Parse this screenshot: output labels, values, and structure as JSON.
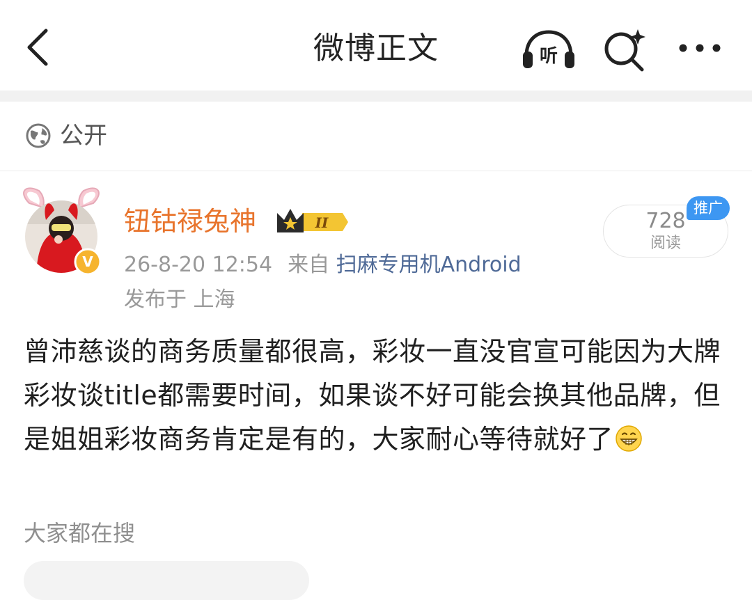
{
  "header": {
    "title": "微博正文",
    "listen_label": "听"
  },
  "visibility": {
    "label": "公开"
  },
  "post": {
    "author": "钮钴禄兔神",
    "rank_badge": "II",
    "timestamp": "26-8-20 12:54",
    "source_prefix": "来自",
    "source_name": "扫麻专用机Android",
    "location": "发布于 上海",
    "read_count": "728",
    "read_label": "阅读",
    "promo_tag": "推广",
    "body_text": "曾沛慈谈的商务质量都很高，彩妆一直没官宣可能因为大牌彩妆谈title都需要时间，如果谈不好可能会换其他品牌，但是姐姐彩妆商务肯定是有的，大家耐心等待就好了",
    "verified_badge": "V"
  },
  "search": {
    "section_title": "大家都在搜"
  },
  "colors": {
    "author_orange": "#e8742c",
    "link_blue": "#4f6a97",
    "promo_blue": "#3d97f2",
    "band_gray": "#f1f1f1"
  },
  "icons": {
    "back": "chevron-left-icon",
    "listen": "headphones-icon",
    "search": "sparkle-search-icon",
    "more": "more-dots-icon",
    "visibility": "globe-icon",
    "emoji": "grin-emoji-icon"
  }
}
